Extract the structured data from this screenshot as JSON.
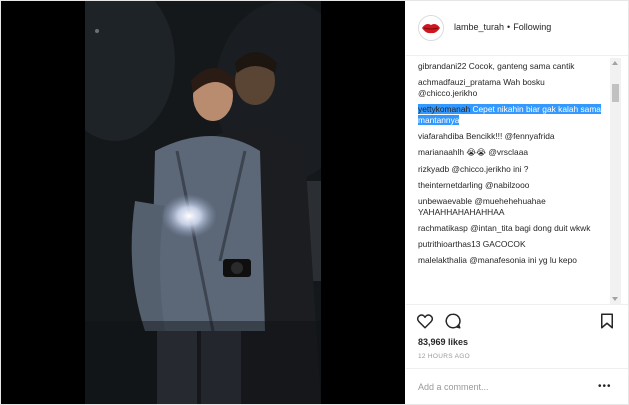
{
  "header": {
    "username": "lambe_turah",
    "separator": "•",
    "follow_status": "Following"
  },
  "comments": [
    {
      "user": "gibrandani22",
      "text": "Cocok, ganteng sama cantik"
    },
    {
      "user": "achmadfauzi_pratama",
      "text": "Wah bosku @chicco.jerikho"
    },
    {
      "user": "yettykomanah",
      "text": "Cepet nikahin biar gak kalah sama mantannya"
    },
    {
      "user": "viafarahdiba",
      "text": "Bencikk!!! @fennyafrida"
    },
    {
      "user": "marianaahlh",
      "text": "😭😭 @vrsclaaa"
    },
    {
      "user": "rizkyadb",
      "text": "@chicco.jerikho ini ?"
    },
    {
      "user": "theinternetdarling",
      "text": "@nabilzooo"
    },
    {
      "user": "unbewaevable",
      "text": "@muehehehuahae YAHAHHAHAHAHHAA"
    },
    {
      "user": "rachmatikasp",
      "text": "@intan_tita bagi dong duit wkwk"
    },
    {
      "user": "putrithioarthas13",
      "text": "GACOCOK"
    },
    {
      "user": "malelakthalia",
      "text": "@manafesonia ini yg lu kepo"
    }
  ],
  "likes": "83,969 likes",
  "timestamp": "12 HOURS AGO",
  "add_comment": {
    "placeholder": "Add a comment...",
    "more_label": "•••"
  },
  "icons": {
    "like": "heart-icon",
    "comment": "comment-bubble-icon",
    "save": "bookmark-icon",
    "avatar": "lips-logo-icon"
  },
  "colors": {
    "selection": "#3399ff",
    "border": "#efefef",
    "muted": "#999999"
  }
}
